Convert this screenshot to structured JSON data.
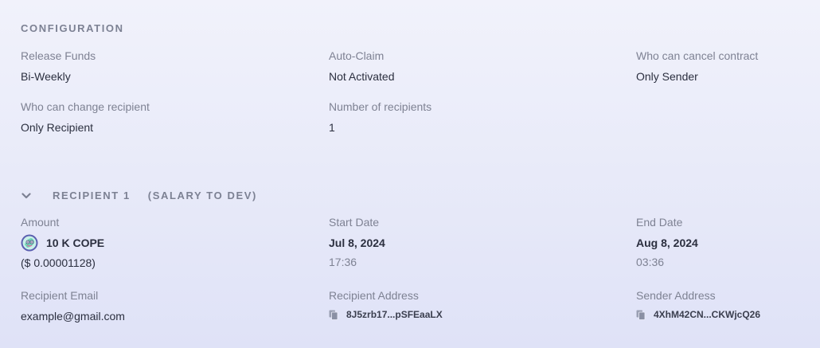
{
  "configuration": {
    "title": "CONFIGURATION",
    "release_funds": {
      "label": "Release Funds",
      "value": "Bi-Weekly"
    },
    "auto_claim": {
      "label": "Auto-Claim",
      "value": "Not Activated"
    },
    "cancel_contract": {
      "label": "Who can cancel contract",
      "value": "Only Sender"
    },
    "change_recipient": {
      "label": "Who can change recipient",
      "value": "Only Recipient"
    },
    "num_recipients": {
      "label": "Number of recipients",
      "value": "1"
    }
  },
  "recipient": {
    "title": "RECIPIENT 1",
    "subtitle": "(SALARY TO DEV)",
    "chevron_icon": "chevron-down-icon",
    "amount": {
      "label": "Amount",
      "value": "10 K COPE",
      "usd": "($ 0.00001128)",
      "token_icon": "cope-token-icon"
    },
    "start_date": {
      "label": "Start Date",
      "date": "Jul 8, 2024",
      "time": "17:36"
    },
    "end_date": {
      "label": "End Date",
      "date": "Aug 8, 2024",
      "time": "03:36"
    },
    "email": {
      "label": "Recipient Email",
      "value": "example@gmail.com"
    },
    "recipient_address": {
      "label": "Recipient Address",
      "value": "8J5zrb17...pSFEaaLX",
      "icon": "copy-icon"
    },
    "sender_address": {
      "label": "Sender Address",
      "value": "4XhM42CN...CKWjcQ26",
      "icon": "copy-icon"
    }
  },
  "colors": {
    "label": "#7e8293",
    "value": "#2b2f3f",
    "heading": "#7c8193"
  }
}
